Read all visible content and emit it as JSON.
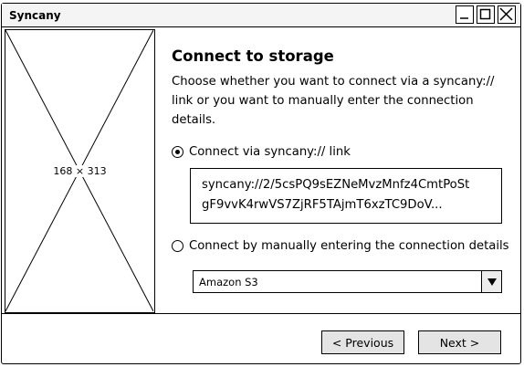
{
  "window": {
    "title": "Syncany",
    "controls": [
      "minimize",
      "maximize",
      "close"
    ]
  },
  "image_placeholder": {
    "label": "168 × 313"
  },
  "page": {
    "heading": "Connect to storage",
    "description_lines": [
      "Choose whether you want to connect via a syncany://",
      "link or you want to manually enter the connection",
      "details."
    ]
  },
  "options": {
    "link": {
      "label": "Connect via syncany:// link",
      "selected": true,
      "value_lines": [
        "syncany://2/5csPQ9sEZNeMvzMnfz4CmtPoSt",
        "gF9vvK4rwVS7ZjRF5TAjmT6xzTC9DoV..."
      ]
    },
    "manual": {
      "label": "Connect by manually entering the connection details",
      "selected": false,
      "storage_type": "Amazon S3"
    }
  },
  "footer": {
    "previous_label": "< Previous",
    "next_label": "Next >"
  },
  "icons": {
    "minimize": "minimize-icon",
    "maximize": "maximize-icon",
    "close": "close-icon",
    "dropdown": "triangle-down-icon"
  }
}
